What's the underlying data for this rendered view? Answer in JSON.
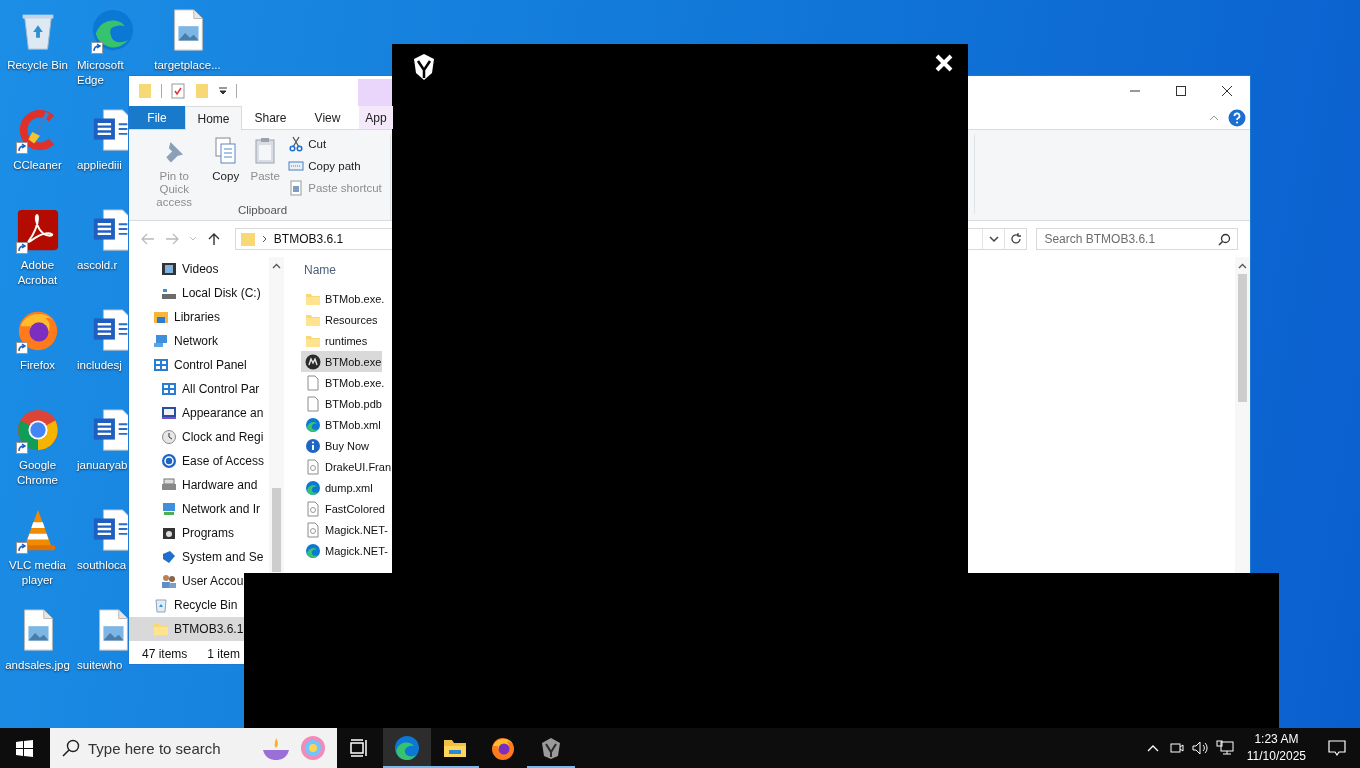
{
  "desktop_icons": [
    [
      {
        "label": "Recycle Bin",
        "kind": "bin",
        "shortcut": false
      },
      {
        "label": "CCleaner",
        "kind": "cleaner",
        "shortcut": true
      },
      {
        "label": "Adobe Acrobat",
        "kind": "pdf",
        "shortcut": true
      },
      {
        "label": "Firefox",
        "kind": "firefox",
        "shortcut": true
      },
      {
        "label": "Google Chrome",
        "kind": "chrome",
        "shortcut": true
      },
      {
        "label": "VLC media player",
        "kind": "cone",
        "shortcut": true
      },
      {
        "label": "andsales.jpg",
        "kind": "image",
        "shortcut": false
      }
    ],
    [
      {
        "label": "Microsoft Edge",
        "kind": "edge",
        "shortcut": true
      },
      {
        "label": "appliediii",
        "kind": "word",
        "shortcut": false
      },
      {
        "label": "ascold.r",
        "kind": "word",
        "shortcut": false
      },
      {
        "label": "includesj",
        "kind": "word",
        "shortcut": false
      },
      {
        "label": "januaryab",
        "kind": "word",
        "shortcut": false
      },
      {
        "label": "southloca",
        "kind": "word",
        "shortcut": false
      },
      {
        "label": "suitewho",
        "kind": "image",
        "shortcut": false
      }
    ],
    [
      {
        "label": "targetplace...",
        "kind": "image",
        "shortcut": false
      }
    ]
  ],
  "explorer": {
    "tabs": [
      {
        "label": "File",
        "kind": "menu",
        "selected": false
      },
      {
        "label": "Home",
        "kind": "tab",
        "selected": true
      },
      {
        "label": "Share",
        "kind": "tab",
        "selected": false
      },
      {
        "label": "View",
        "kind": "tab",
        "selected": false
      },
      {
        "label": "App",
        "kind": "context",
        "selected": false
      }
    ],
    "ribbon": {
      "group": "Clipboard",
      "buttons": [
        {
          "label": "Pin to Quick access",
          "kind": "pin",
          "disabled": true
        },
        {
          "label": "Copy",
          "kind": "copy",
          "disabled": false
        },
        {
          "label": "Paste",
          "kind": "paste",
          "disabled": true
        },
        {
          "label": "Cut",
          "kind": "cut",
          "disabled": false
        },
        {
          "label": "Copy path",
          "kind": "path",
          "disabled": false
        },
        {
          "label": "Paste shortcut",
          "kind": "shortcut",
          "disabled": true
        }
      ]
    },
    "address": {
      "path": "BTMOB3.6.1"
    },
    "search": {
      "placeholder": "Search BTMOB3.6.1"
    },
    "nav_tree": [
      {
        "children": [
          {
            "label": "Videos",
            "kind": "video",
            "selected": false
          },
          {
            "label": "Local Disk (C:)",
            "kind": "disk",
            "selected": false
          }
        ]
      },
      {
        "label": "Libraries",
        "kind": "libraries",
        "selected": false
      },
      {
        "label": "Network",
        "kind": "network",
        "selected": false
      },
      {
        "label": "Control Panel",
        "kind": "panel",
        "selected": false,
        "children": [
          {
            "label": "All Control Par",
            "kind": "panel",
            "selected": false
          },
          {
            "label": "Appearance an",
            "kind": "appearance",
            "selected": false
          },
          {
            "label": "Clock and Regi",
            "kind": "clock",
            "selected": false
          },
          {
            "label": "Ease of Access",
            "kind": "access",
            "selected": false
          },
          {
            "label": "Hardware and",
            "kind": "hardware",
            "selected": false
          },
          {
            "label": "Network and Ir",
            "kind": "netcenter",
            "selected": false
          },
          {
            "label": "Programs",
            "kind": "programs",
            "selected": false
          },
          {
            "label": "System and Se",
            "kind": "security",
            "selected": false
          },
          {
            "label": "User Accou",
            "kind": "users",
            "selected": false
          }
        ]
      },
      {
        "label": "Recycle Bin",
        "kind": "bin",
        "selected": false
      },
      {
        "label": "BTMOB3.6.1",
        "kind": "folder",
        "selected": true
      }
    ],
    "columns": [
      "Name"
    ],
    "files": [
      {
        "name": "BTMob.exe.",
        "kind": "folder",
        "selected": false
      },
      {
        "name": "Resources",
        "kind": "folder",
        "selected": false
      },
      {
        "name": "runtimes",
        "kind": "folder",
        "selected": false
      },
      {
        "name": "BTMob.exe",
        "kind": "app",
        "selected": true
      },
      {
        "name": "BTMob.exe.",
        "kind": "file",
        "selected": false
      },
      {
        "name": "BTMob.pdb",
        "kind": "file",
        "selected": false
      },
      {
        "name": "BTMob.xml",
        "kind": "edge",
        "selected": false
      },
      {
        "name": "Buy Now",
        "kind": "info",
        "selected": false
      },
      {
        "name": "DrakeUI.Fran",
        "kind": "library",
        "selected": false
      },
      {
        "name": "dump.xml",
        "kind": "edge",
        "selected": false
      },
      {
        "name": "FastColored",
        "kind": "library",
        "selected": false
      },
      {
        "name": "Magick.NET-",
        "kind": "library",
        "selected": false
      },
      {
        "name": "Magick.NET-",
        "kind": "edge",
        "selected": false
      }
    ],
    "status": [
      "47 items",
      "1 item"
    ]
  },
  "taskbar": {
    "search": {
      "placeholder": "Type here to search"
    },
    "apps": [
      {
        "kind": "edge",
        "selected": true,
        "running": true
      },
      {
        "kind": "explorer",
        "selected": false,
        "running": true
      },
      {
        "kind": "firefox",
        "selected": false,
        "running": false
      },
      {
        "kind": "mask",
        "selected": false,
        "running": true
      }
    ],
    "time": "1:23 AM",
    "date": "11/10/2025"
  }
}
